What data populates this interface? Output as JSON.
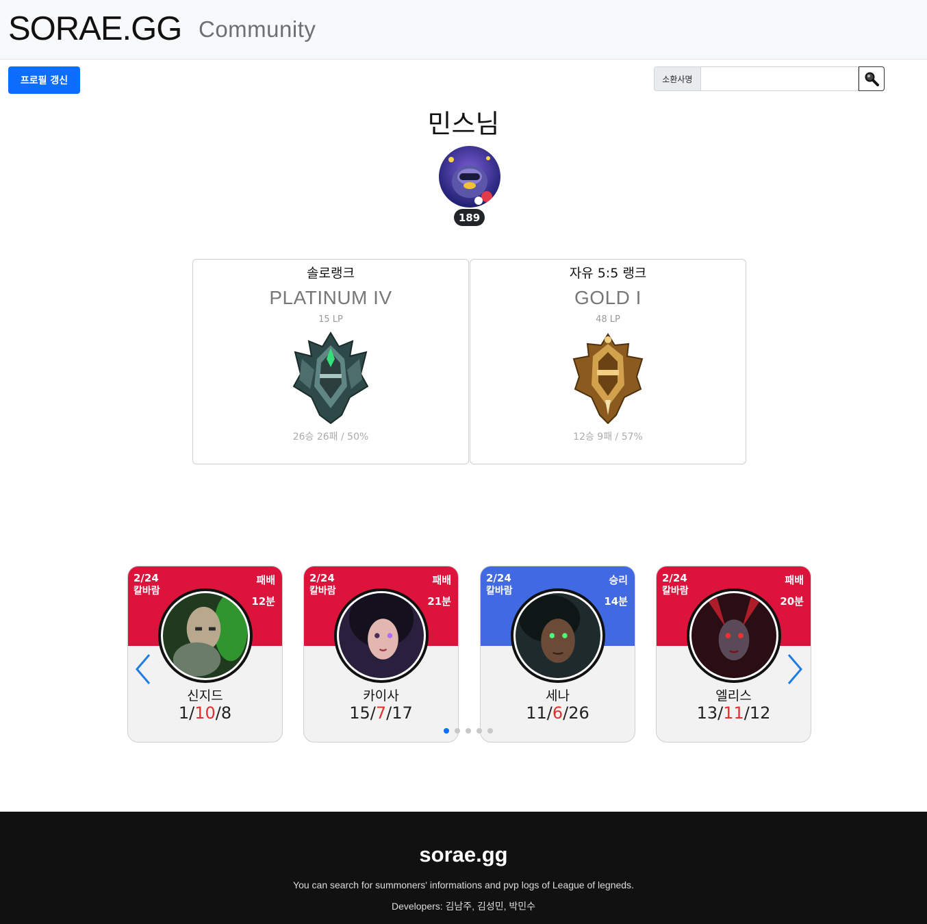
{
  "header": {
    "brand": "SORAE.GG",
    "nav_community": "Community"
  },
  "toolbar": {
    "refresh_label": "프로필 갱신",
    "search_label": "소환사명",
    "search_value": ""
  },
  "colors": {
    "primary": "#0d6efd",
    "loss": "#dc143c",
    "win": "#4169e1",
    "death": "#e03131"
  },
  "profile": {
    "name": "민스님",
    "level": "189"
  },
  "ranks": [
    {
      "queue": "솔로랭크",
      "tier": "PLATINUM IV",
      "lp": "15 LP",
      "record": "26승 26패 / 50%"
    },
    {
      "queue": "자유 5:5 랭크",
      "tier": "GOLD I",
      "lp": "48 LP",
      "record": "12승 9패 / 57%"
    }
  ],
  "matches": [
    {
      "date": "2/24",
      "mode": "칼바람",
      "result": "패배",
      "duration": "12분",
      "champion": "신지드",
      "kills": "1",
      "deaths": "10",
      "assists": "8"
    },
    {
      "date": "2/24",
      "mode": "칼바람",
      "result": "패배",
      "duration": "21분",
      "champion": "카이사",
      "kills": "15",
      "deaths": "7",
      "assists": "17"
    },
    {
      "date": "2/24",
      "mode": "칼바람",
      "result": "승리",
      "duration": "14분",
      "champion": "세나",
      "kills": "11",
      "deaths": "6",
      "assists": "26"
    },
    {
      "date": "2/24",
      "mode": "칼바람",
      "result": "패배",
      "duration": "20분",
      "champion": "엘리스",
      "kills": "13",
      "deaths": "11",
      "assists": "12"
    }
  ],
  "carousel": {
    "page": 1,
    "pages": 5
  },
  "footer": {
    "title": "sorae.gg",
    "description": "You can search for summoners' informations and pvp logs of League of legneds.",
    "developers": "Developers: 김남주, 김성민, 박민수"
  }
}
